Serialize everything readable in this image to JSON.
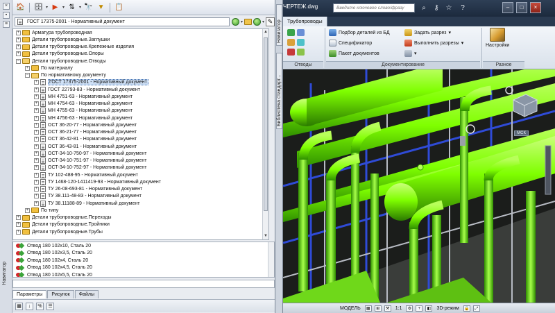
{
  "navigator": {
    "side_strip_label": "Навигатор",
    "path_value": "ГОСТ 17375-2001 - Нормативный документ",
    "tree": [
      {
        "level": 0,
        "kind": "folder",
        "expander": "+",
        "label": "Арматура трубопроводная"
      },
      {
        "level": 0,
        "kind": "folder",
        "expander": "+",
        "label": "Детали трубопроводные.Заглушки"
      },
      {
        "level": 0,
        "kind": "folder",
        "expander": "+",
        "label": "Детали трубопроводные.Крепежные изделия"
      },
      {
        "level": 0,
        "kind": "folder",
        "expander": "+",
        "label": "Детали трубопроводные.Опоры"
      },
      {
        "level": 0,
        "kind": "folder",
        "expander": "−",
        "label": "Детали трубопроводные.Отводы"
      },
      {
        "level": 1,
        "kind": "folder",
        "expander": "+",
        "label": "По материалу"
      },
      {
        "level": 1,
        "kind": "folder",
        "expander": "−",
        "label": "По нормативному документу"
      },
      {
        "level": 2,
        "kind": "doc",
        "expander": "+",
        "label": "ГОСТ 17375-2001 - Нормативный документ",
        "selected": true
      },
      {
        "level": 2,
        "kind": "doc",
        "expander": "+",
        "label": "ГОСТ 22793-83 - Нормативный документ"
      },
      {
        "level": 2,
        "kind": "doc",
        "expander": "+",
        "label": "МН 4751-63 - Нормативный документ"
      },
      {
        "level": 2,
        "kind": "doc",
        "expander": "+",
        "label": "МН 4754-63 - Нормативный документ"
      },
      {
        "level": 2,
        "kind": "doc",
        "expander": "+",
        "label": "МН 4755-63 - Нормативный документ"
      },
      {
        "level": 2,
        "kind": "doc",
        "expander": "+",
        "label": "МН 4756-63 - Нормативный документ"
      },
      {
        "level": 2,
        "kind": "doc",
        "expander": "+",
        "label": "ОСТ 36-20-77 - Нормативный документ"
      },
      {
        "level": 2,
        "kind": "doc",
        "expander": "+",
        "label": "ОСТ 36-21-77 - Нормативный документ"
      },
      {
        "level": 2,
        "kind": "doc",
        "expander": "+",
        "label": "ОСТ 36-42-81 - Нормативный документ"
      },
      {
        "level": 2,
        "kind": "doc",
        "expander": "+",
        "label": "ОСТ 36-43-81 - Нормативный документ"
      },
      {
        "level": 2,
        "kind": "doc",
        "expander": "+",
        "label": "ОСТ-34-10-750-97 - Нормативный документ"
      },
      {
        "level": 2,
        "kind": "doc",
        "expander": "+",
        "label": "ОСТ-34-10-751-97 - Нормативный документ"
      },
      {
        "level": 2,
        "kind": "doc",
        "expander": "+",
        "label": "ОСТ-34-10-752-97 - Нормативный документ"
      },
      {
        "level": 2,
        "kind": "doc",
        "expander": "+",
        "label": "ТУ 102-488-95 - Нормативный документ"
      },
      {
        "level": 2,
        "kind": "doc",
        "expander": "+",
        "label": "ТУ 1468-120-1411419-93 - Нормативный документ"
      },
      {
        "level": 2,
        "kind": "doc",
        "expander": "+",
        "label": "ТУ 26-08-693-81 - Нормативный документ"
      },
      {
        "level": 2,
        "kind": "doc",
        "expander": "+",
        "label": "ТУ 38.111-48-83 - Нормативный документ"
      },
      {
        "level": 2,
        "kind": "doc",
        "expander": "+",
        "label": "ТУ 38.11188-89 - Нормативный документ"
      },
      {
        "level": 1,
        "kind": "folder",
        "expander": "+",
        "label": "По типу"
      },
      {
        "level": 0,
        "kind": "folder",
        "expander": "+",
        "label": "Детали трубопроводные.Переходы"
      },
      {
        "level": 0,
        "kind": "folder",
        "expander": "+",
        "label": "Детали трубопроводные.Тройники"
      },
      {
        "level": 0,
        "kind": "folder",
        "expander": "+",
        "label": "Детали трубопроводные.Трубы"
      }
    ],
    "parts": [
      "Отвод 180 102х10, Сталь 20",
      "Отвод 180 102х3,5, Сталь 20",
      "Отвод 180 102х4, Сталь 20",
      "Отвод 180 102х4,5, Сталь 20",
      "Отвод 180 102х5,5, Сталь 20"
    ],
    "tabs": [
      "Параметры",
      "Рисунок",
      "Файлы"
    ],
    "active_tab": "Параметры"
  },
  "palette_strip": {
    "tab1": "Навигатор",
    "tab2": "Библиотека стандарт..."
  },
  "cad": {
    "title": "ЧЕРТЕЖ.dwg",
    "search_placeholder": "Введите ключевое слово/фразу",
    "ribbon_tab": "Трубопроводы",
    "buttons": {
      "parts_from_db": "Подбор деталей из БД",
      "set_section": "Задать разрез",
      "spec": "Спецификатор",
      "run_sections": "Выполнить разрезы",
      "doc_package": "Пакет документов",
      "settings": "Настройки"
    },
    "group_labels": {
      "bends": "Отводы",
      "documentation": "Документирование",
      "misc": "Разное"
    },
    "view_cube_label": "МСК",
    "status": {
      "model": "МОДЕЛЬ",
      "scale": "1:1",
      "mode": "3D-режим"
    },
    "colors": {
      "pipe_green": "#7fff00",
      "steel_blue": "#2f4bd6",
      "frame_gray": "#b8bcc4"
    }
  }
}
